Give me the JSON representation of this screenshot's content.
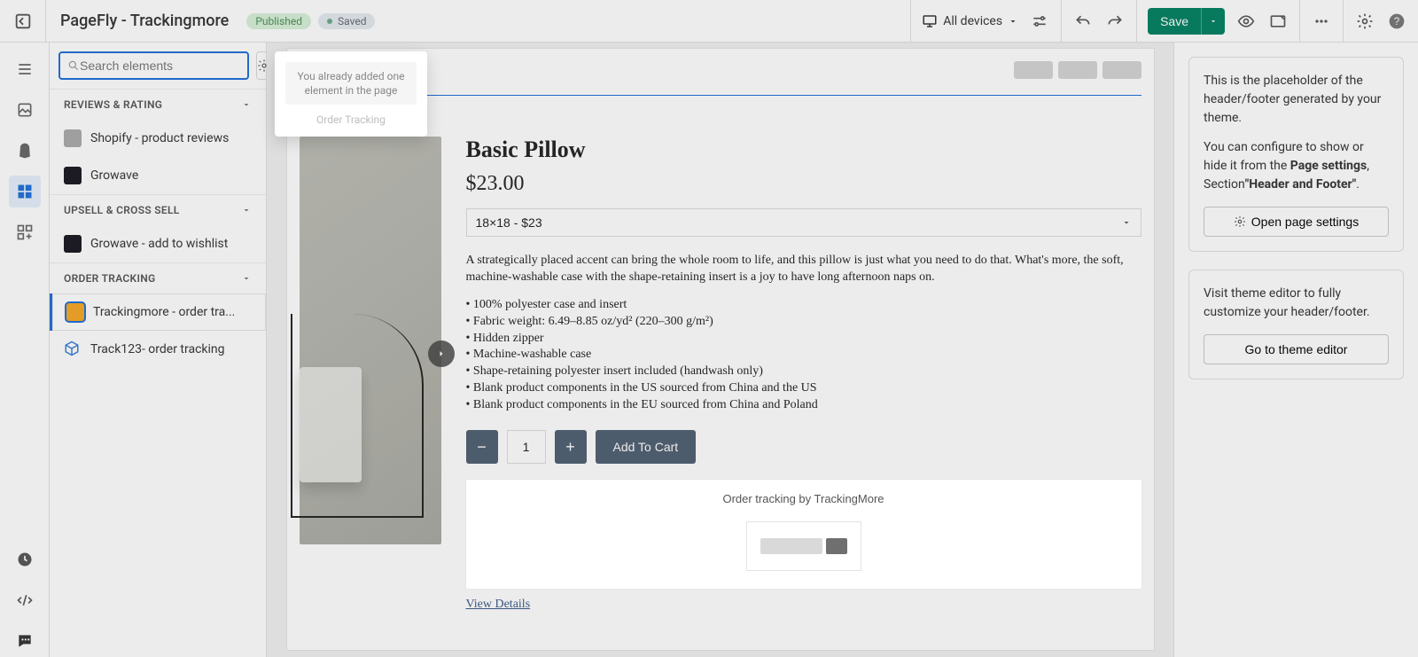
{
  "header": {
    "title": "PageFly - Trackingmore",
    "published_label": "Published",
    "saved_label": "Saved",
    "device_label": "All devices",
    "save_label": "Save"
  },
  "sidebar": {
    "search_placeholder": "Search elements",
    "sections": [
      {
        "title": "REVIEWS & RATING",
        "items": [
          {
            "label": "Shopify - product reviews",
            "icon": "shopify"
          },
          {
            "label": "Growave",
            "icon": "growave"
          }
        ]
      },
      {
        "title": "UPSELL & CROSS SELL",
        "items": [
          {
            "label": "Growave - add to wishlist",
            "icon": "growave"
          }
        ]
      },
      {
        "title": "ORDER TRACKING",
        "items": [
          {
            "label": "Trackingmore - order tra...",
            "icon": "tm",
            "selected": true
          },
          {
            "label": "Track123- order tracking",
            "icon": "tr"
          }
        ]
      }
    ]
  },
  "popover": {
    "message": "You already added one element in the page",
    "label": "Order Tracking"
  },
  "product": {
    "name": "Basic Pillow",
    "price": "$23.00",
    "variant": "18×18 - $23",
    "description": "A strategically placed accent can bring the whole room to life, and this pillow is just what you need to do that. What's more, the soft, machine-washable case with the shape-retaining insert is a joy to have long afternoon naps on.",
    "bullets": [
      "• 100% polyester case and insert",
      "• Fabric weight: 6.49–8.85 oz/yd² (220–300 g/m²)",
      "• Hidden zipper",
      "• Machine-washable case",
      "• Shape-retaining polyester insert included (handwash only)",
      "• Blank product components in the US sourced from China and the US",
      "• Blank product components in the EU sourced from China and Poland"
    ],
    "qty": "1",
    "add_to_cart": "Add To Cart",
    "tracking_title": "Order tracking by TrackingMore",
    "view_details": "View Details"
  },
  "right": {
    "box1_line1": "This is the placeholder of the header/footer generated by your theme.",
    "box1_line2a": "You can configure to show or hide it from the ",
    "box1_bold1": "Page settings",
    "box1_mid": ", Section",
    "box1_bold2": "\"Header and Footer\"",
    "box1_button": "Open page settings",
    "box2_text": "Visit theme editor to fully customize your header/footer.",
    "box2_button": "Go to theme editor"
  }
}
